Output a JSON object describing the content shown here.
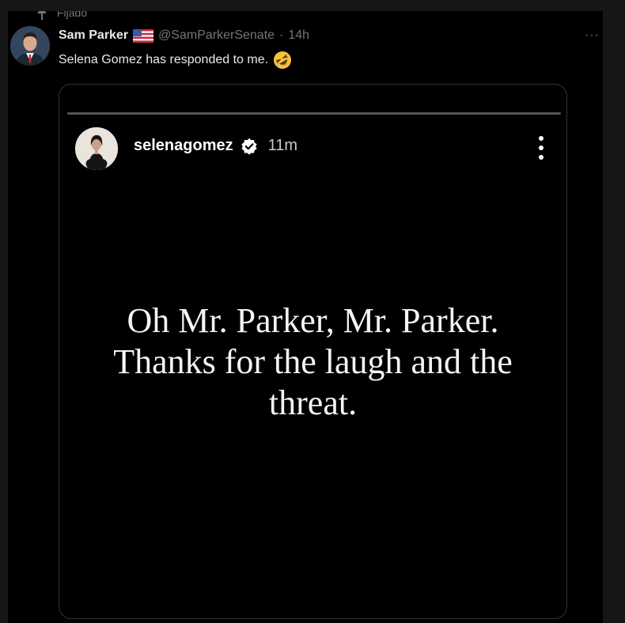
{
  "pinned_label": "Fijado",
  "tweet": {
    "display_name": "Sam Parker",
    "flag_icon": "us-flag-icon",
    "handle": "@SamParkerSenate",
    "separator": "·",
    "time": "14h",
    "more_label": "···",
    "text": "Selena Gomez has responded to me.",
    "emoji_icon": "rolling-on-floor-laughing-emoji"
  },
  "story": {
    "username": "selenagomez",
    "verified_icon": "verified-badge-icon",
    "time": "11m",
    "text_lines": [
      "Oh Mr. Parker, Mr. Parker.",
      "Thanks for the laugh and the",
      "threat."
    ]
  },
  "colors": {
    "background": "#000000",
    "text_primary": "#e7e9ea",
    "text_secondary": "#71767b",
    "border": "#2f3336"
  }
}
